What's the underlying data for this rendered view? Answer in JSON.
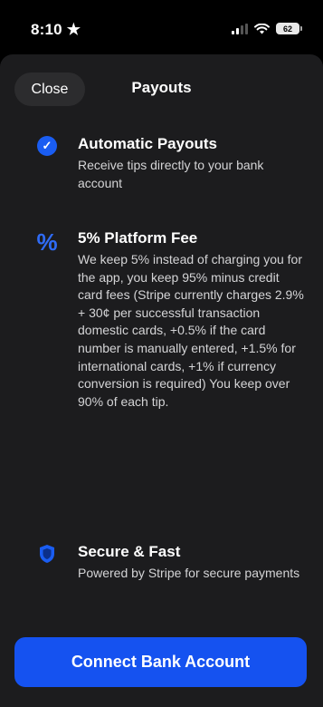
{
  "status_bar": {
    "time": "8:10",
    "time_icon": "star-icon",
    "battery": "62"
  },
  "header": {
    "close_label": "Close",
    "title": "Payouts"
  },
  "features": [
    {
      "icon": "check-circle-icon",
      "title": "Automatic Payouts",
      "description": "Receive tips directly to your bank account"
    },
    {
      "icon": "percent-icon",
      "title": "5% Platform Fee",
      "description": "We keep 5% instead of charging you for the app, you keep 95% minus credit card fees (Stripe currently charges 2.9% + 30¢ per successful transaction domestic cards, +0.5% if the card number is manually entered, +1.5% for international cards, +1% if currency conversion is required) You keep over 90% of each tip."
    },
    {
      "icon": "shield-icon",
      "title": "Secure & Fast",
      "description": "Powered by Stripe for secure payments"
    }
  ],
  "connect_button_label": "Connect Bank Account",
  "colors": {
    "accent": "#1552f0",
    "sheet_background": "#1c1c1e",
    "background": "#000000"
  }
}
